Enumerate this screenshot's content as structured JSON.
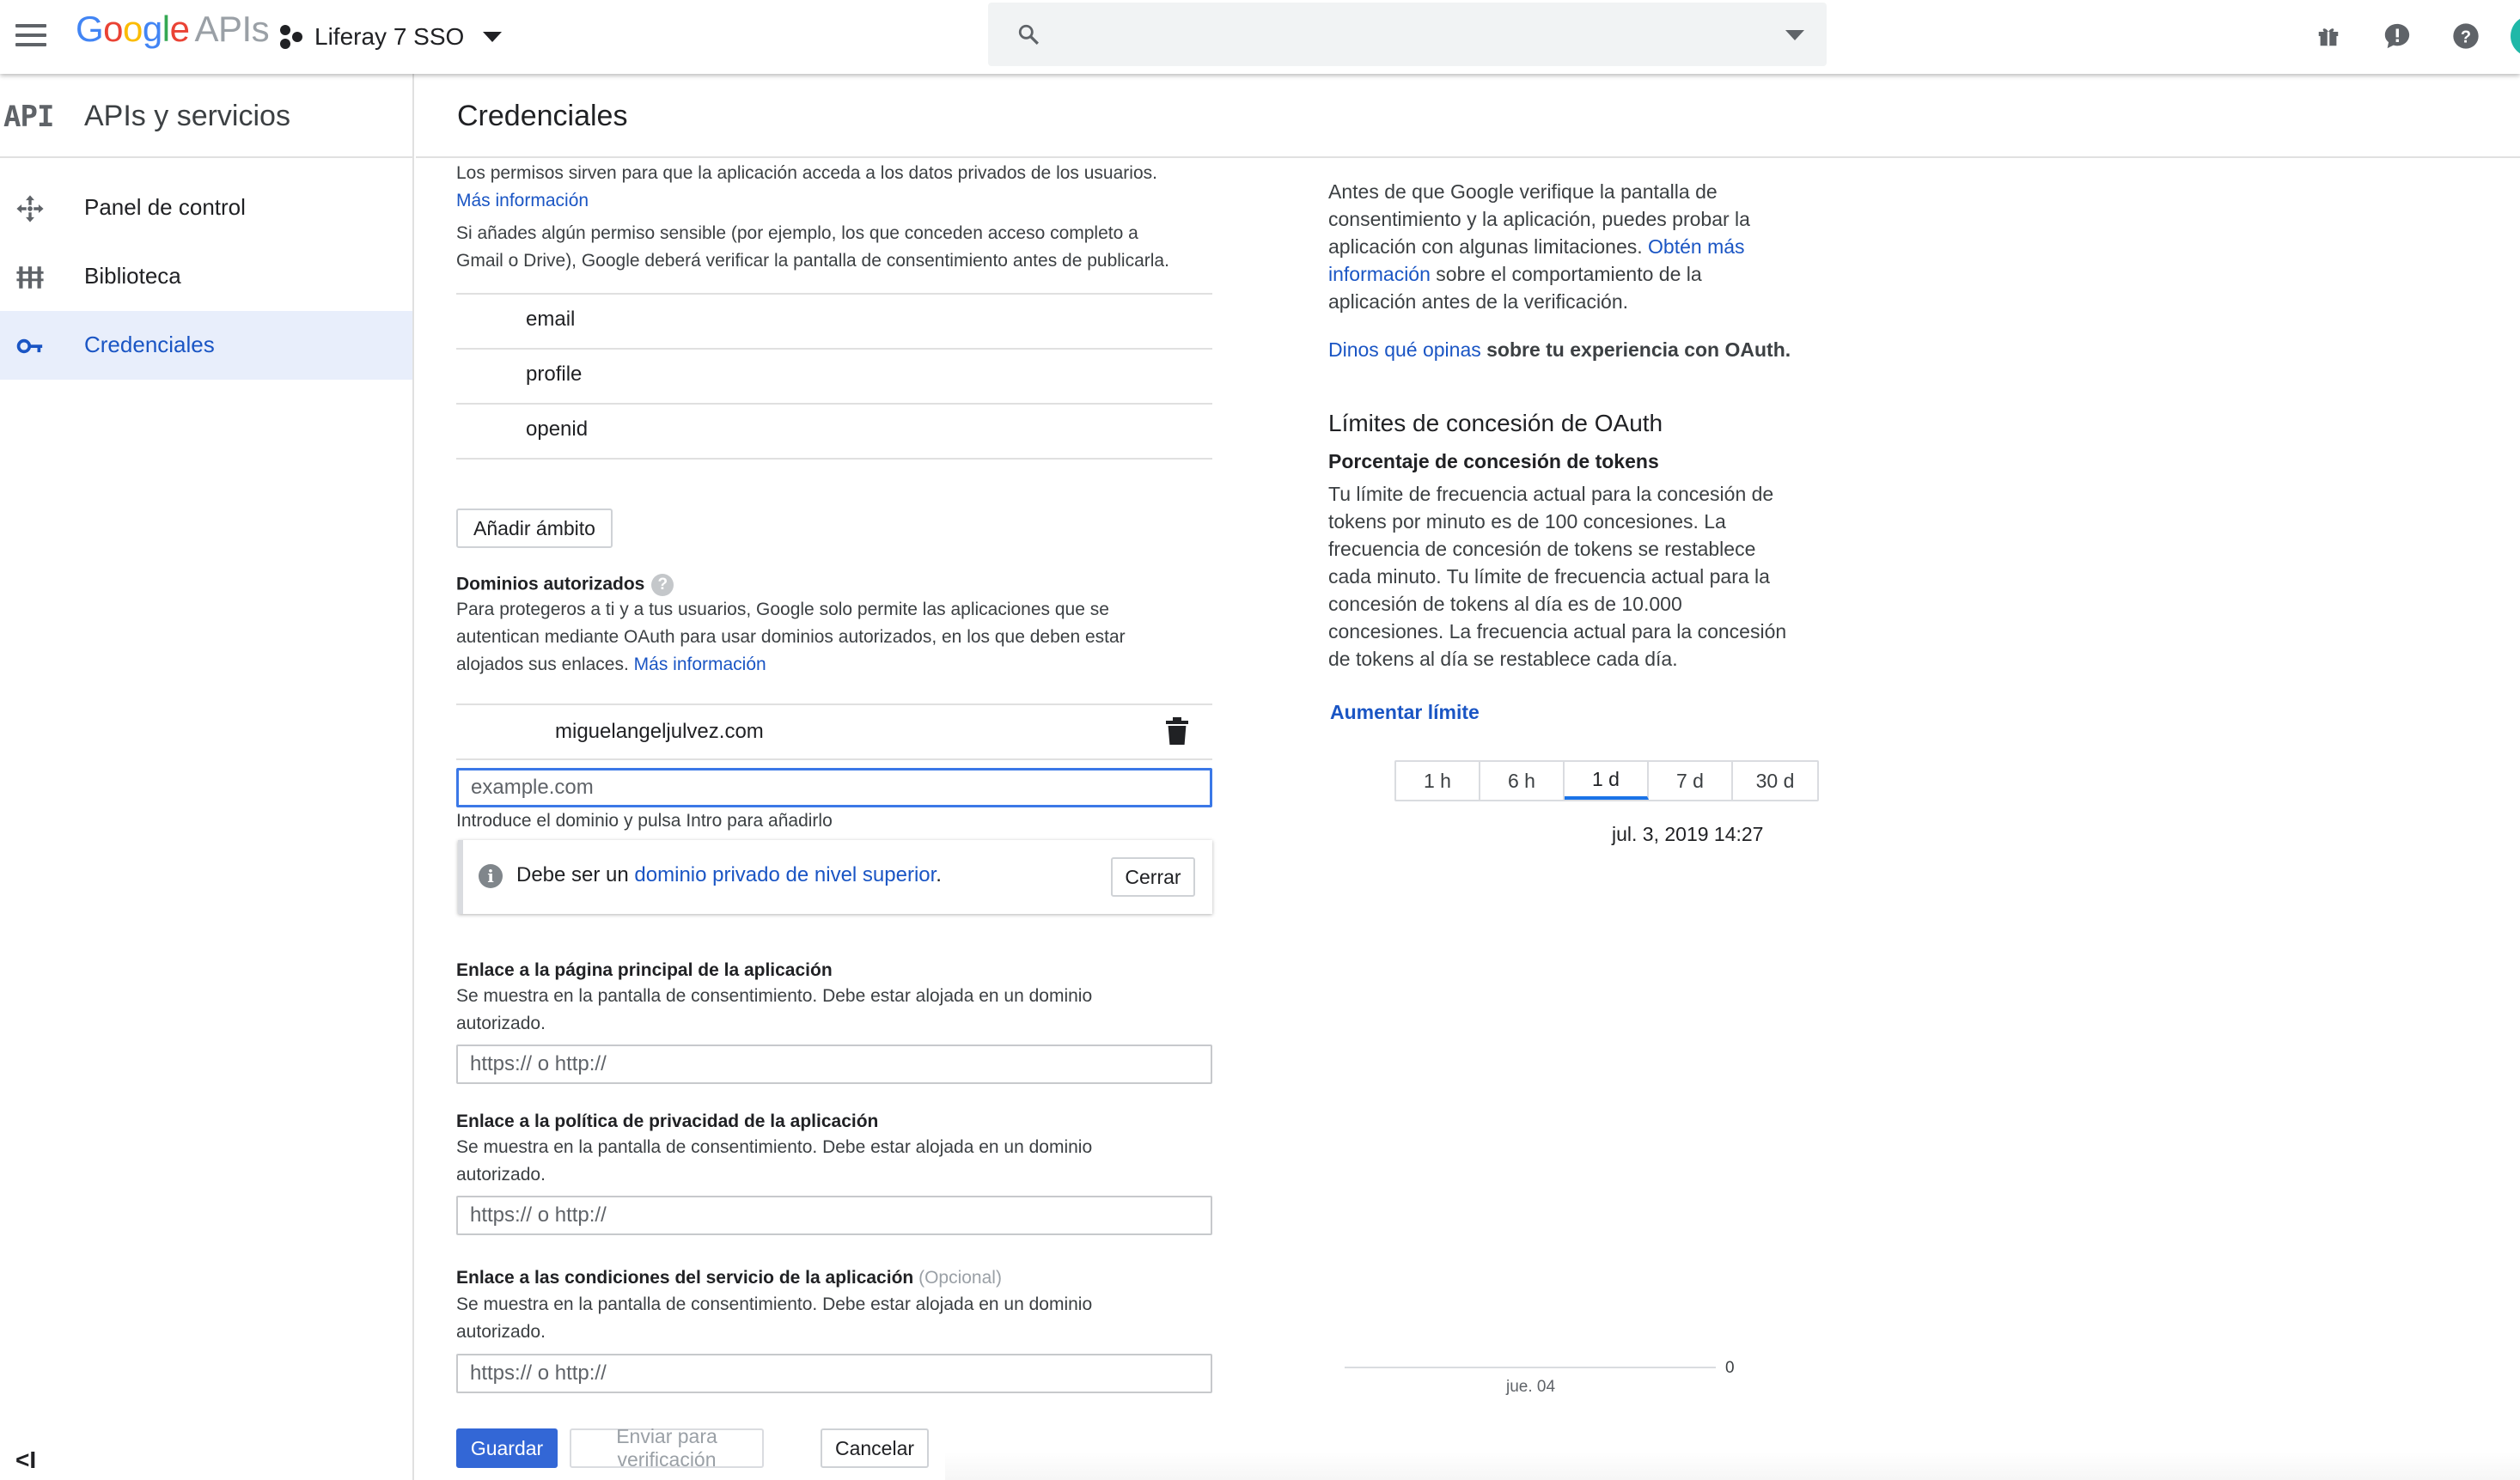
{
  "header": {
    "logo_google": [
      "G",
      "o",
      "o",
      "g",
      "l",
      "e"
    ],
    "logo_apis": "APIs",
    "project_name": "Liferay 7 SSO",
    "search_placeholder": ""
  },
  "sidebar": {
    "badge": "API",
    "title": "APIs y servicios",
    "items": [
      {
        "label": "Panel de control",
        "icon": "dashboard-icon"
      },
      {
        "label": "Biblioteca",
        "icon": "library-icon"
      },
      {
        "label": "Credenciales",
        "icon": "key-icon",
        "active": true
      }
    ],
    "collapse_label": "<I"
  },
  "page": {
    "title": "Credenciales"
  },
  "scopes": {
    "intro_line1": "Los permisos sirven para que la aplicación acceda a los datos privados de los usuarios.",
    "more_info": "Más información",
    "sensitive_line1": "Si añades algún permiso sensible (por ejemplo, los que conceden acceso completo a",
    "sensitive_line2": "Gmail o Drive), Google deberá verificar la pantalla de consentimiento antes de publicarla.",
    "items": [
      "email",
      "profile",
      "openid"
    ],
    "add_button": "Añadir ámbito"
  },
  "domains": {
    "label": "Dominios autorizados",
    "help": "?",
    "desc_line1": "Para protegeros a ti y a tus usuarios, Google solo permite las aplicaciones que se",
    "desc_line2": "autentican mediante OAuth para usar dominios autorizados, en los que deben estar",
    "desc_line3": "alojados sus enlaces.",
    "more_info": "Más información",
    "existing": "miguelangeljulvez.com",
    "input_placeholder": "example.com",
    "input_hint": "Introduce el dominio y pulsa Intro para añadirlo",
    "alert_prefix": "Debe ser un ",
    "alert_link": "dominio privado de nivel superior",
    "alert_suffix": ".",
    "alert_close": "Cerrar"
  },
  "homepage": {
    "label": "Enlace a la página principal de la aplicación",
    "desc_line1": "Se muestra en la pantalla de consentimiento. Debe estar alojada en un dominio",
    "desc_line2": "autorizado.",
    "placeholder": "https:// o http://"
  },
  "privacy": {
    "label": "Enlace a la política de privacidad de la aplicación",
    "desc_line1": "Se muestra en la pantalla de consentimiento. Debe estar alojada en un dominio",
    "desc_line2": "autorizado.",
    "placeholder": "https:// o http://"
  },
  "tos": {
    "label": "Enlace a las condiciones del servicio de la aplicación",
    "optional": "(Opcional)",
    "desc_line1": "Se muestra en la pantalla de consentimiento. Debe estar alojada en un dominio",
    "desc_line2": "autorizado.",
    "placeholder": "https:// o http://"
  },
  "actions": {
    "save": "Guardar",
    "submit": "Enviar para verificación",
    "cancel": "Cancelar"
  },
  "right": {
    "verify_line1": "Antes de que Google verifique la pantalla de",
    "verify_line2": "consentimiento y la aplicación, puedes probar la",
    "verify_line3a": "aplicación con algunas limitaciones. ",
    "verify_link_a": "Obtén más",
    "verify_link_b": "información",
    "verify_line4b": " sobre el comportamiento de la",
    "verify_line5": "aplicación antes de la verificación.",
    "feedback_link": "Dinos qué opinas",
    "feedback_text": " sobre tu experiencia con OAuth.",
    "limits_title": "Límites de concesión de OAuth",
    "limits_subtitle": "Porcentaje de concesión de tokens",
    "limits_lines": [
      "Tu límite de frecuencia actual para la concesión de",
      "tokens por minuto es de 100 concesiones. La",
      "frecuencia de concesión de tokens se restablece",
      "cada minuto. Tu límite de frecuencia actual para la",
      "concesión de tokens al día es de 10.000",
      "concesiones. La frecuencia actual para la concesión",
      "de tokens al día se restablece cada día."
    ],
    "increase_link": "Aumentar límite",
    "ranges": [
      "1 h",
      "6 h",
      "1 d",
      "7 d",
      "30 d"
    ],
    "selected_range": "1 d",
    "chart_timestamp": "jul. 3, 2019 14:27",
    "chart_tick": "jue. 04",
    "chart_zero": "0"
  },
  "colors": {
    "link": "#1a55c4",
    "primary_button": "#3367d6",
    "active_nav_bg": "#e8eefb",
    "focus_border": "#3b78e7"
  }
}
